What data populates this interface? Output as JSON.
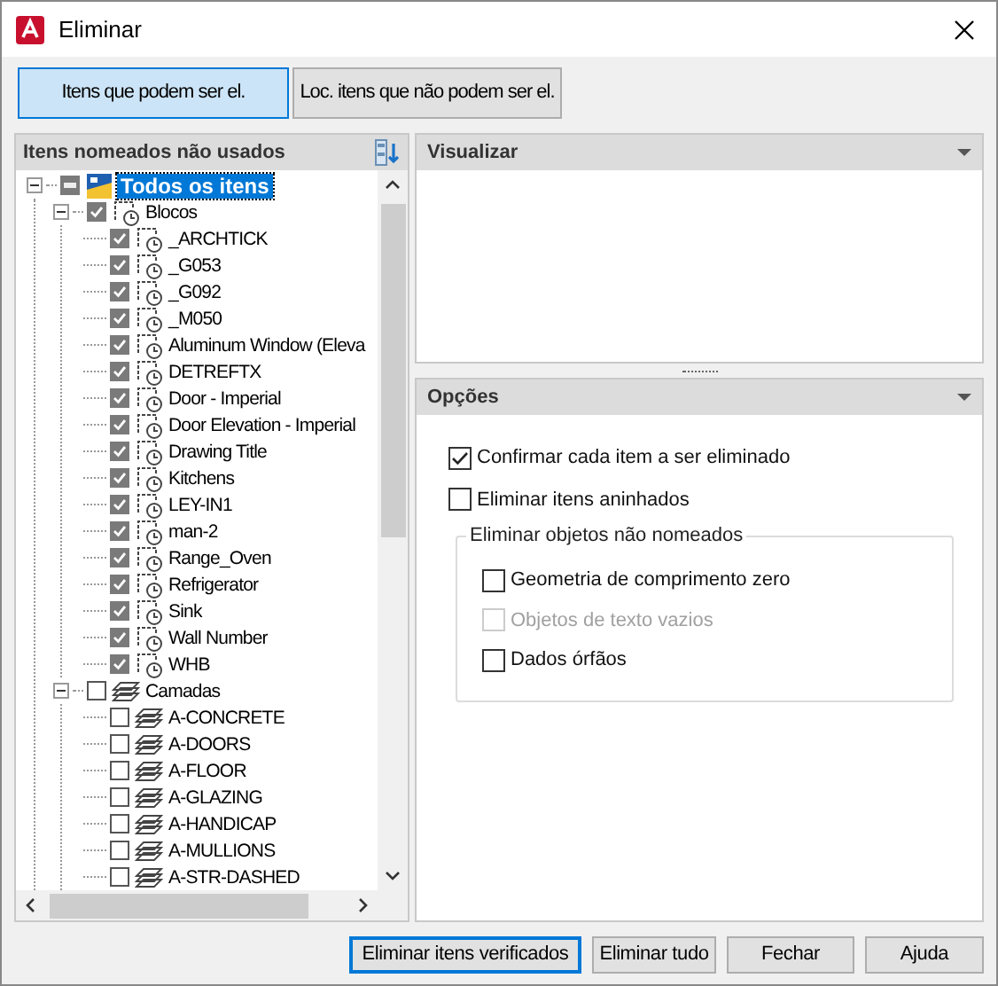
{
  "window": {
    "title": "Eliminar"
  },
  "tabs": [
    {
      "label": "Itens que podem ser el.",
      "selected": true
    },
    {
      "label": "Loc. itens que não podem ser el.",
      "selected": false
    }
  ],
  "tree_panel": {
    "title": "Itens nomeados não usados",
    "tree": [
      {
        "label": "Todos os itens",
        "kind": "root",
        "checked": false,
        "indeterminate": true,
        "selected": true,
        "expanded": true,
        "children": [
          {
            "label": "Blocos",
            "kind": "block",
            "checked": true,
            "indeterminate": false,
            "selected": false,
            "expanded": true,
            "children": [
              {
                "label": "_ARCHTICK",
                "kind": "block",
                "checked": true,
                "indeterminate": false,
                "selected": false
              },
              {
                "label": "_G053",
                "kind": "block",
                "checked": true,
                "indeterminate": false,
                "selected": false
              },
              {
                "label": "_G092",
                "kind": "block",
                "checked": true,
                "indeterminate": false,
                "selected": false
              },
              {
                "label": "_M050",
                "kind": "block",
                "checked": true,
                "indeterminate": false,
                "selected": false
              },
              {
                "label": "Aluminum Window (Eleva",
                "kind": "block",
                "checked": true,
                "indeterminate": false,
                "selected": false
              },
              {
                "label": "DETREFTX",
                "kind": "block",
                "checked": true,
                "indeterminate": false,
                "selected": false
              },
              {
                "label": "Door - Imperial",
                "kind": "block",
                "checked": true,
                "indeterminate": false,
                "selected": false
              },
              {
                "label": "Door Elevation - Imperial",
                "kind": "block",
                "checked": true,
                "indeterminate": false,
                "selected": false
              },
              {
                "label": "Drawing Title",
                "kind": "block",
                "checked": true,
                "indeterminate": false,
                "selected": false
              },
              {
                "label": "Kitchens",
                "kind": "block",
                "checked": true,
                "indeterminate": false,
                "selected": false
              },
              {
                "label": "LEY-IN1",
                "kind": "block",
                "checked": true,
                "indeterminate": false,
                "selected": false
              },
              {
                "label": "man-2",
                "kind": "block",
                "checked": true,
                "indeterminate": false,
                "selected": false
              },
              {
                "label": "Range_Oven",
                "kind": "block",
                "checked": true,
                "indeterminate": false,
                "selected": false
              },
              {
                "label": "Refrigerator",
                "kind": "block",
                "checked": true,
                "indeterminate": false,
                "selected": false
              },
              {
                "label": "Sink",
                "kind": "block",
                "checked": true,
                "indeterminate": false,
                "selected": false
              },
              {
                "label": "Wall Number",
                "kind": "block",
                "checked": true,
                "indeterminate": false,
                "selected": false
              },
              {
                "label": "WHB",
                "kind": "block",
                "checked": true,
                "indeterminate": false,
                "selected": false
              }
            ]
          },
          {
            "label": "Camadas",
            "kind": "layer",
            "checked": false,
            "indeterminate": false,
            "selected": false,
            "expanded": true,
            "children": [
              {
                "label": "A-CONCRETE",
                "kind": "layer",
                "checked": false,
                "indeterminate": false,
                "selected": false
              },
              {
                "label": "A-DOORS",
                "kind": "layer",
                "checked": false,
                "indeterminate": false,
                "selected": false
              },
              {
                "label": "A-FLOOR",
                "kind": "layer",
                "checked": false,
                "indeterminate": false,
                "selected": false
              },
              {
                "label": "A-GLAZING",
                "kind": "layer",
                "checked": false,
                "indeterminate": false,
                "selected": false
              },
              {
                "label": "A-HANDICAP",
                "kind": "layer",
                "checked": false,
                "indeterminate": false,
                "selected": false
              },
              {
                "label": "A-MULLIONS",
                "kind": "layer",
                "checked": false,
                "indeterminate": false,
                "selected": false
              },
              {
                "label": "A-STR-DASHED",
                "kind": "layer",
                "checked": false,
                "indeterminate": false,
                "selected": false
              }
            ]
          }
        ]
      }
    ]
  },
  "preview_panel": {
    "title": "Visualizar"
  },
  "options_panel": {
    "title": "Opções",
    "options": [
      {
        "label": "Confirmar cada item a ser eliminado",
        "checked": true,
        "disabled": false
      },
      {
        "label": "Eliminar itens aninhados",
        "checked": false,
        "disabled": false
      }
    ],
    "group": {
      "title": "Eliminar objetos não nomeados",
      "options": [
        {
          "label": "Geometria de comprimento zero",
          "checked": false,
          "disabled": false
        },
        {
          "label": "Objetos de texto vazios",
          "checked": false,
          "disabled": true
        },
        {
          "label": "Dados órfãos",
          "checked": false,
          "disabled": false
        }
      ]
    }
  },
  "buttons": [
    {
      "label": "Eliminar itens verificados",
      "default": true
    },
    {
      "label": "Eliminar tudo",
      "default": false
    },
    {
      "label": "Fechar",
      "default": false
    },
    {
      "label": "Ajuda",
      "default": false
    }
  ]
}
